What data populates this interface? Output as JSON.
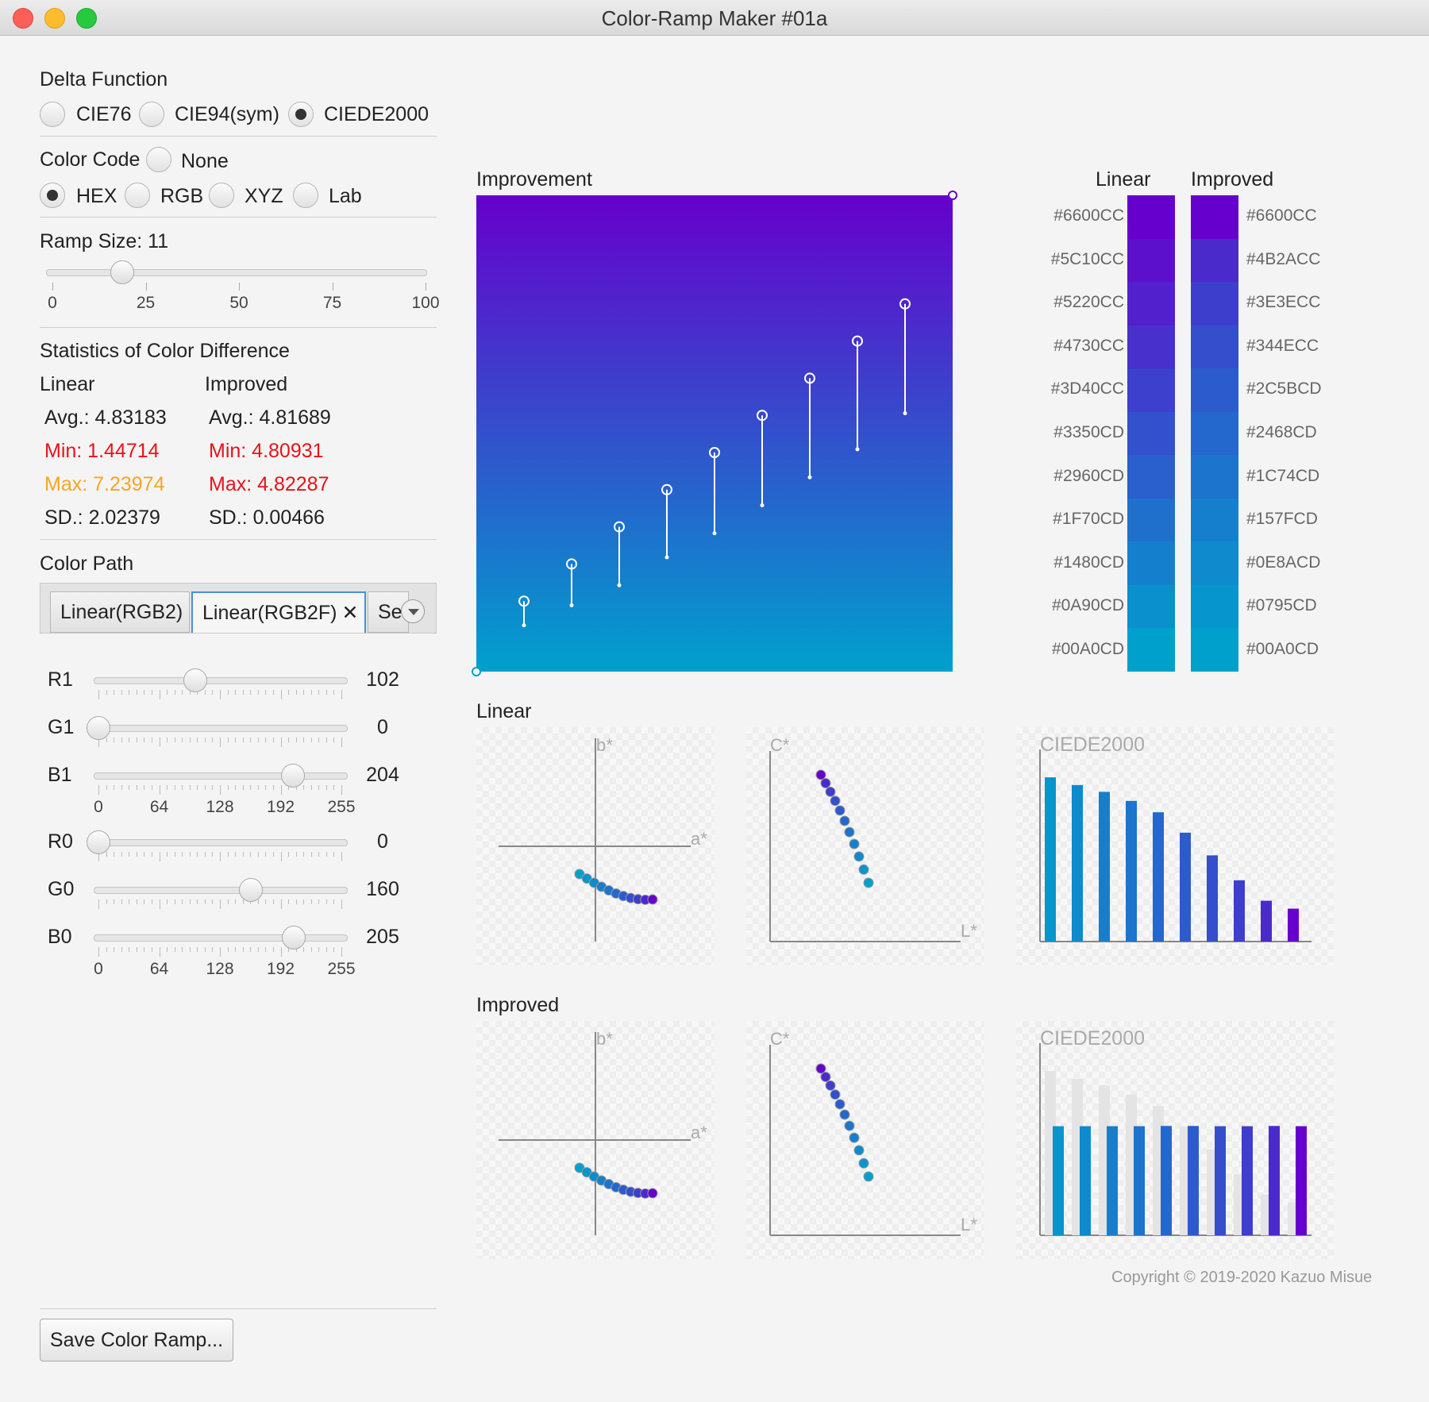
{
  "window": {
    "title": "Color-Ramp Maker #01a"
  },
  "delta_function": {
    "label": "Delta Function",
    "options": [
      "CIE76",
      "CIE94(sym)",
      "CIEDE2000"
    ],
    "selected": "CIEDE2000"
  },
  "color_code": {
    "label": "Color Code",
    "options": [
      "None",
      "HEX",
      "RGB",
      "XYZ",
      "Lab"
    ],
    "selected": "HEX"
  },
  "ramp_size": {
    "label": "Ramp Size: 11",
    "value": 11,
    "ticks": [
      "0",
      "25",
      "50",
      "75",
      "100"
    ]
  },
  "statistics": {
    "title": "Statistics of Color Difference",
    "linear": {
      "header": "Linear",
      "avg": "Avg.:  4.83183",
      "min": "Min:  1.44714",
      "max": "Max:  7.23974",
      "sd": "SD.:  2.02379"
    },
    "improved": {
      "header": "Improved",
      "avg": "Avg.:  4.81689",
      "min": "Min:  4.80931",
      "max": "Max:  4.82287",
      "sd": "SD.:  0.00466"
    }
  },
  "color_path": {
    "label": "Color Path",
    "tabs": [
      "Linear(RGB2)",
      "Linear(RGB2F)",
      "Se"
    ],
    "close_glyph": "✕",
    "sliders1": [
      {
        "label": "R1",
        "value": "102"
      },
      {
        "label": "G1",
        "value": "0"
      },
      {
        "label": "B1",
        "value": "204"
      }
    ],
    "sliders0": [
      {
        "label": "R0",
        "value": "0"
      },
      {
        "label": "G0",
        "value": "160"
      },
      {
        "label": "B0",
        "value": "205"
      }
    ],
    "ticks": [
      "0",
      "64",
      "128",
      "192",
      "255"
    ]
  },
  "save_button": "Save Color Ramp...",
  "improvement_title": "Improvement",
  "ramp_headers": {
    "linear": "Linear",
    "improved": "Improved"
  },
  "linear_hex": [
    "#6600CC",
    "#5C10CC",
    "#5220CC",
    "#4730CC",
    "#3D40CC",
    "#3350CD",
    "#2960CD",
    "#1F70CD",
    "#1480CD",
    "#0A90CD",
    "#00A0CD"
  ],
  "improved_hex": [
    "#6600CC",
    "#4B2ACC",
    "#3E3ECC",
    "#344ECC",
    "#2C5BCD",
    "#2468CD",
    "#1C74CD",
    "#157FCD",
    "#0E8ACD",
    "#0795CD",
    "#00A0CD"
  ],
  "linear_section": "Linear",
  "improved_section": "Improved",
  "axis": {
    "b": "b*",
    "a": "a*",
    "c": "C*",
    "l": "L*",
    "ciede": "CIEDE2000"
  },
  "chart_data": [
    {
      "type": "bar",
      "title": "CIEDE2000",
      "section": "Linear",
      "values": [
        7.24,
        6.9,
        6.6,
        6.2,
        5.7,
        4.8,
        3.8,
        2.7,
        1.8,
        1.45
      ]
    },
    {
      "type": "bar",
      "title": "CIEDE2000",
      "section": "Improved",
      "values": [
        4.81,
        4.81,
        4.81,
        4.81,
        4.82,
        4.82,
        4.81,
        4.81,
        4.82,
        4.81
      ]
    }
  ],
  "copyright": "Copyright © 2019-2020 Kazuo Misue"
}
